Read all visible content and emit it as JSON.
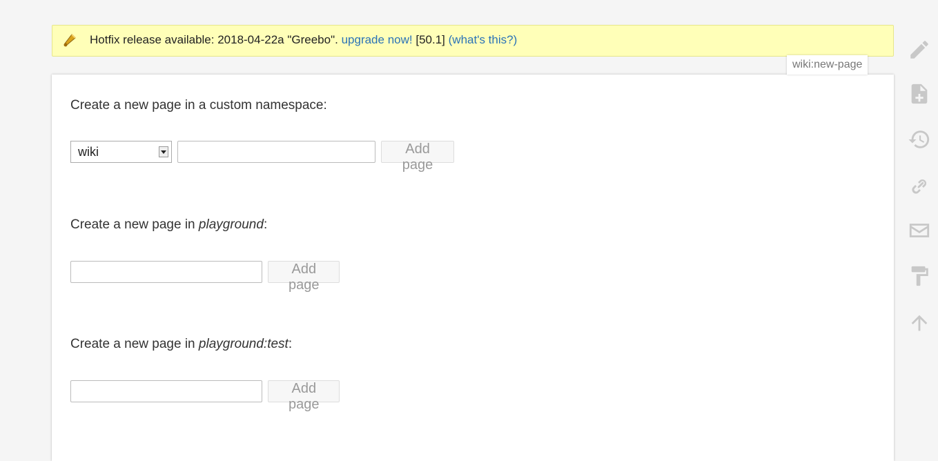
{
  "notification": {
    "message": "Hotfix release available: 2018-04-22a \"Greebo\".",
    "upgrade_link": "upgrade now!",
    "version": "[50.1]",
    "whats_this_link": "(what's this?)"
  },
  "page_id": "wiki:new-page",
  "sections": [
    {
      "label_prefix": "Create a new page in a custom namespace:",
      "namespace_select": "wiki",
      "input_value": "",
      "button": "Add page"
    },
    {
      "label_prefix": "Create a new page in ",
      "label_namespace": "playground",
      "label_suffix": ":",
      "input_value": "",
      "button": "Add page"
    },
    {
      "label_prefix": "Create a new page in ",
      "label_namespace": "playground:test",
      "label_suffix": ":",
      "input_value": "",
      "button": "Add page"
    }
  ],
  "sidebar_tools": [
    "edit-icon",
    "new-page-icon",
    "history-icon",
    "backlinks-icon",
    "subscribe-icon",
    "format-paint-icon",
    "back-to-top-icon"
  ],
  "colors": {
    "notify_bg": "#ffffb8",
    "link": "#2b73b7",
    "icon": "#c8c8c8"
  }
}
